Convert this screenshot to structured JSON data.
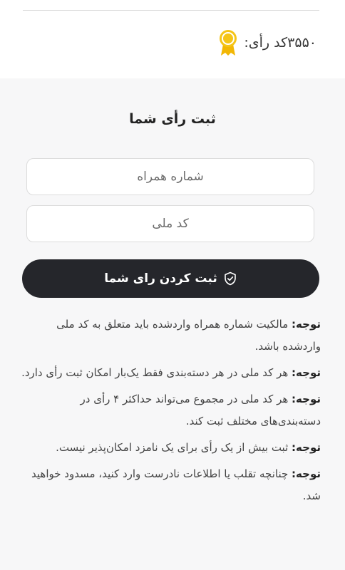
{
  "vote_code": {
    "label": "کد رأی:",
    "value": "۳۵۵۰",
    "icon": "medal-icon",
    "icon_color": "#f5c518"
  },
  "form": {
    "title": "ثبت رأی شما",
    "phone_placeholder": "شماره همراه",
    "national_id_placeholder": "کد ملی",
    "submit_label": "ثبت کردن رای شما",
    "submit_icon": "shield-check-icon",
    "submit_bg": "#25262b"
  },
  "notes": [
    {
      "prefix": "توجه:",
      "text": "مالکیت شماره همراه واردشده باید متعلق به کد ملی واردشده باشد."
    },
    {
      "prefix": "توجه:",
      "text": "هر کد ملی در هر دسته‌بندی فقط یک‌بار امکان ثبت رأی دارد."
    },
    {
      "prefix": "توجه:",
      "text": "هر کد ملی در مجموع می‌تواند حداکثر ۴ رأی در دسته‌بندی‌های مختلف ثبت کند."
    },
    {
      "prefix": "توجه:",
      "text": "ثبت بیش از یک رأی برای یک نامزد امکان‌پذیر نیست."
    },
    {
      "prefix": "توجه:",
      "text": "چنانچه تقلب یا اطلاعات نادرست وارد کنید، مسدود خواهید شد."
    }
  ]
}
